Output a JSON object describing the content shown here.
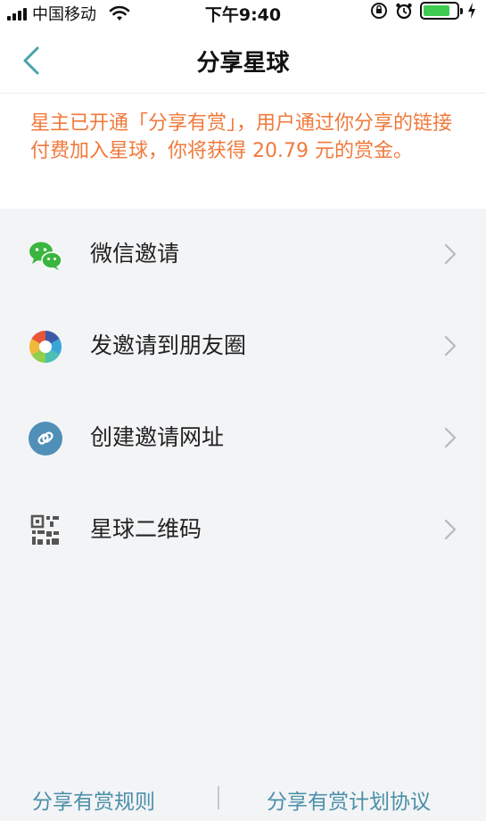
{
  "status_bar": {
    "carrier": "中国移动",
    "time": "下午9:40",
    "battery_level": 0.8,
    "battery_color": "#3ecb4f"
  },
  "nav": {
    "back_icon": "chevron-left-icon",
    "title": "分享星球"
  },
  "notice": {
    "text": "星主已开通「分享有赏」，用户通过你分享的链接付费加入星球，你将获得 20.79 元的赏金。",
    "color": "#f07a3c"
  },
  "menu": {
    "items": [
      {
        "label": "微信邀请",
        "icon": "wechat-icon"
      },
      {
        "label": "发邀请到朋友圈",
        "icon": "moments-icon"
      },
      {
        "label": "创建邀请网址",
        "icon": "link-icon"
      },
      {
        "label": "星球二维码",
        "icon": "qr-code-icon"
      }
    ]
  },
  "footer": {
    "rules_label": "分享有赏规则",
    "agreement_label": "分享有赏计划协议",
    "link_color": "#4a8fa8"
  }
}
